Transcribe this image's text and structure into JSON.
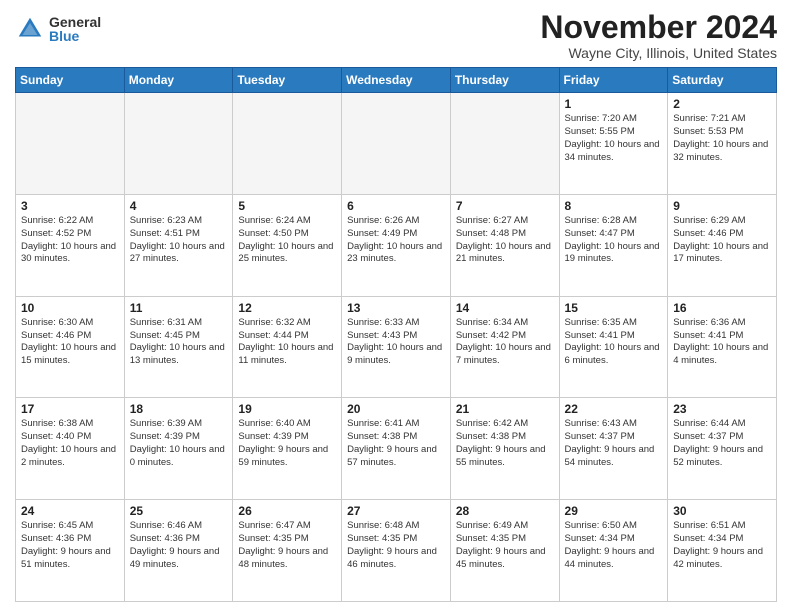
{
  "header": {
    "logo_general": "General",
    "logo_blue": "Blue",
    "month_title": "November 2024",
    "location": "Wayne City, Illinois, United States"
  },
  "days_of_week": [
    "Sunday",
    "Monday",
    "Tuesday",
    "Wednesday",
    "Thursday",
    "Friday",
    "Saturday"
  ],
  "weeks": [
    [
      {
        "day": "",
        "empty": true
      },
      {
        "day": "",
        "empty": true
      },
      {
        "day": "",
        "empty": true
      },
      {
        "day": "",
        "empty": true
      },
      {
        "day": "",
        "empty": true
      },
      {
        "day": "1",
        "sunrise": "Sunrise: 7:20 AM",
        "sunset": "Sunset: 5:55 PM",
        "daylight": "Daylight: 10 hours and 34 minutes."
      },
      {
        "day": "2",
        "sunrise": "Sunrise: 7:21 AM",
        "sunset": "Sunset: 5:53 PM",
        "daylight": "Daylight: 10 hours and 32 minutes."
      }
    ],
    [
      {
        "day": "3",
        "sunrise": "Sunrise: 6:22 AM",
        "sunset": "Sunset: 4:52 PM",
        "daylight": "Daylight: 10 hours and 30 minutes."
      },
      {
        "day": "4",
        "sunrise": "Sunrise: 6:23 AM",
        "sunset": "Sunset: 4:51 PM",
        "daylight": "Daylight: 10 hours and 27 minutes."
      },
      {
        "day": "5",
        "sunrise": "Sunrise: 6:24 AM",
        "sunset": "Sunset: 4:50 PM",
        "daylight": "Daylight: 10 hours and 25 minutes."
      },
      {
        "day": "6",
        "sunrise": "Sunrise: 6:26 AM",
        "sunset": "Sunset: 4:49 PM",
        "daylight": "Daylight: 10 hours and 23 minutes."
      },
      {
        "day": "7",
        "sunrise": "Sunrise: 6:27 AM",
        "sunset": "Sunset: 4:48 PM",
        "daylight": "Daylight: 10 hours and 21 minutes."
      },
      {
        "day": "8",
        "sunrise": "Sunrise: 6:28 AM",
        "sunset": "Sunset: 4:47 PM",
        "daylight": "Daylight: 10 hours and 19 minutes."
      },
      {
        "day": "9",
        "sunrise": "Sunrise: 6:29 AM",
        "sunset": "Sunset: 4:46 PM",
        "daylight": "Daylight: 10 hours and 17 minutes."
      }
    ],
    [
      {
        "day": "10",
        "sunrise": "Sunrise: 6:30 AM",
        "sunset": "Sunset: 4:46 PM",
        "daylight": "Daylight: 10 hours and 15 minutes."
      },
      {
        "day": "11",
        "sunrise": "Sunrise: 6:31 AM",
        "sunset": "Sunset: 4:45 PM",
        "daylight": "Daylight: 10 hours and 13 minutes."
      },
      {
        "day": "12",
        "sunrise": "Sunrise: 6:32 AM",
        "sunset": "Sunset: 4:44 PM",
        "daylight": "Daylight: 10 hours and 11 minutes."
      },
      {
        "day": "13",
        "sunrise": "Sunrise: 6:33 AM",
        "sunset": "Sunset: 4:43 PM",
        "daylight": "Daylight: 10 hours and 9 minutes."
      },
      {
        "day": "14",
        "sunrise": "Sunrise: 6:34 AM",
        "sunset": "Sunset: 4:42 PM",
        "daylight": "Daylight: 10 hours and 7 minutes."
      },
      {
        "day": "15",
        "sunrise": "Sunrise: 6:35 AM",
        "sunset": "Sunset: 4:41 PM",
        "daylight": "Daylight: 10 hours and 6 minutes."
      },
      {
        "day": "16",
        "sunrise": "Sunrise: 6:36 AM",
        "sunset": "Sunset: 4:41 PM",
        "daylight": "Daylight: 10 hours and 4 minutes."
      }
    ],
    [
      {
        "day": "17",
        "sunrise": "Sunrise: 6:38 AM",
        "sunset": "Sunset: 4:40 PM",
        "daylight": "Daylight: 10 hours and 2 minutes."
      },
      {
        "day": "18",
        "sunrise": "Sunrise: 6:39 AM",
        "sunset": "Sunset: 4:39 PM",
        "daylight": "Daylight: 10 hours and 0 minutes."
      },
      {
        "day": "19",
        "sunrise": "Sunrise: 6:40 AM",
        "sunset": "Sunset: 4:39 PM",
        "daylight": "Daylight: 9 hours and 59 minutes."
      },
      {
        "day": "20",
        "sunrise": "Sunrise: 6:41 AM",
        "sunset": "Sunset: 4:38 PM",
        "daylight": "Daylight: 9 hours and 57 minutes."
      },
      {
        "day": "21",
        "sunrise": "Sunrise: 6:42 AM",
        "sunset": "Sunset: 4:38 PM",
        "daylight": "Daylight: 9 hours and 55 minutes."
      },
      {
        "day": "22",
        "sunrise": "Sunrise: 6:43 AM",
        "sunset": "Sunset: 4:37 PM",
        "daylight": "Daylight: 9 hours and 54 minutes."
      },
      {
        "day": "23",
        "sunrise": "Sunrise: 6:44 AM",
        "sunset": "Sunset: 4:37 PM",
        "daylight": "Daylight: 9 hours and 52 minutes."
      }
    ],
    [
      {
        "day": "24",
        "sunrise": "Sunrise: 6:45 AM",
        "sunset": "Sunset: 4:36 PM",
        "daylight": "Daylight: 9 hours and 51 minutes."
      },
      {
        "day": "25",
        "sunrise": "Sunrise: 6:46 AM",
        "sunset": "Sunset: 4:36 PM",
        "daylight": "Daylight: 9 hours and 49 minutes."
      },
      {
        "day": "26",
        "sunrise": "Sunrise: 6:47 AM",
        "sunset": "Sunset: 4:35 PM",
        "daylight": "Daylight: 9 hours and 48 minutes."
      },
      {
        "day": "27",
        "sunrise": "Sunrise: 6:48 AM",
        "sunset": "Sunset: 4:35 PM",
        "daylight": "Daylight: 9 hours and 46 minutes."
      },
      {
        "day": "28",
        "sunrise": "Sunrise: 6:49 AM",
        "sunset": "Sunset: 4:35 PM",
        "daylight": "Daylight: 9 hours and 45 minutes."
      },
      {
        "day": "29",
        "sunrise": "Sunrise: 6:50 AM",
        "sunset": "Sunset: 4:34 PM",
        "daylight": "Daylight: 9 hours and 44 minutes."
      },
      {
        "day": "30",
        "sunrise": "Sunrise: 6:51 AM",
        "sunset": "Sunset: 4:34 PM",
        "daylight": "Daylight: 9 hours and 42 minutes."
      }
    ]
  ]
}
